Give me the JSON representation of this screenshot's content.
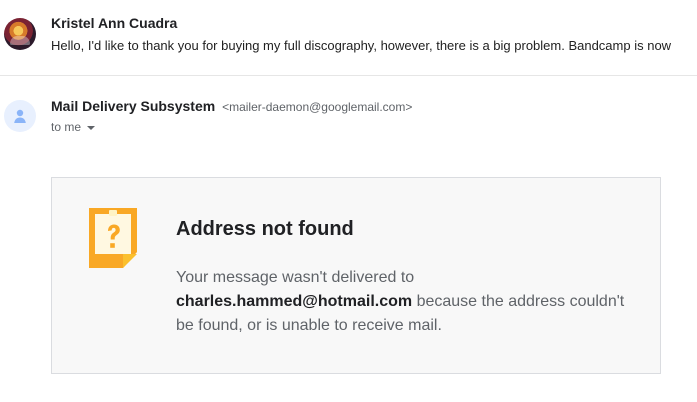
{
  "thread_preview": {
    "sender": "Kristel Ann Cuadra",
    "snippet": "Hello, I'd like to thank you for buying my full discography, however, there is a big problem. Bandcamp is now"
  },
  "message": {
    "sender_name": "Mail Delivery Subsystem",
    "sender_email": "<mailer-daemon@googlemail.com>",
    "to": "to me"
  },
  "notice": {
    "icon": "question-mark-warning-icon",
    "title": "Address not found",
    "body_before": "Your message wasn't delivered to ",
    "address": "charles.hammed@hotmail.com",
    "body_after": " because the address couldn't be found, or is unable to receive mail."
  },
  "colors": {
    "notice_icon": "#f9a825",
    "default_avatar": "#8ab4f8"
  }
}
